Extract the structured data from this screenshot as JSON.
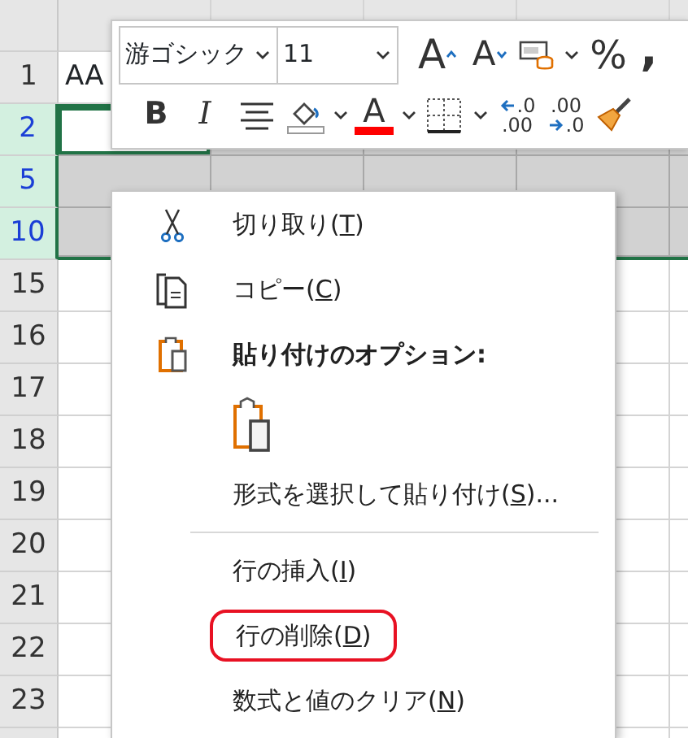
{
  "rows": [
    {
      "number": "1",
      "selected": false,
      "active_cell": false,
      "cells": [
        "AA"
      ]
    },
    {
      "number": "2",
      "selected": true,
      "active_cell": true
    },
    {
      "number": "5",
      "selected": true,
      "active_cell": false
    },
    {
      "number": "10",
      "selected": true,
      "active_cell": false
    },
    {
      "number": "15",
      "selected": false,
      "active_cell": false
    },
    {
      "number": "16",
      "selected": false,
      "active_cell": false
    },
    {
      "number": "17",
      "selected": false,
      "active_cell": false
    },
    {
      "number": "18",
      "selected": false,
      "active_cell": false
    },
    {
      "number": "19",
      "selected": false,
      "active_cell": false
    },
    {
      "number": "20",
      "selected": false,
      "active_cell": false
    },
    {
      "number": "21",
      "selected": false,
      "active_cell": false
    },
    {
      "number": "22",
      "selected": false,
      "active_cell": false
    },
    {
      "number": "23",
      "selected": false,
      "active_cell": false
    }
  ],
  "mini_toolbar": {
    "font": "游ゴシック",
    "size": "11",
    "row_1": [
      {
        "kind": "grow-font",
        "text": "A",
        "dropdown": false
      },
      {
        "kind": "shrink-font",
        "text": "A",
        "dropdown": false
      },
      {
        "kind": "format",
        "dropdown": true
      },
      {
        "kind": "percent",
        "text": "%",
        "dropdown": false
      },
      {
        "kind": "comma",
        "text": ",",
        "dropdown": false
      }
    ],
    "row_2": [
      {
        "kind": "bold",
        "text": "B",
        "dropdown": false
      },
      {
        "kind": "italic",
        "text": "I",
        "dropdown": false
      },
      {
        "kind": "align",
        "dropdown": false
      },
      {
        "kind": "fill",
        "dropdown": true
      },
      {
        "kind": "font-color",
        "text": "A",
        "color": "#ff0000",
        "dropdown": true
      },
      {
        "kind": "borders",
        "dropdown": true
      },
      {
        "kind": "increase-decimal",
        "text": ".0",
        "text_2": ".00",
        "dropdown": false
      },
      {
        "kind": "decrease-decimal",
        "text": ".00",
        "text_2": ".0",
        "dropdown": false
      },
      {
        "kind": "brush",
        "dropdown": false
      }
    ]
  },
  "context_menu": {
    "items": [
      {
        "kind": "command",
        "label": [
          "切り取り(",
          "T",
          ")"
        ],
        "highlighted": false
      },
      {
        "kind": "command",
        "label": [
          "コピー(",
          "C",
          ")"
        ],
        "highlighted": false
      },
      {
        "kind": "heading",
        "label": [
          "貼り付けのオプション:"
        ]
      },
      {
        "kind": "paste-options"
      },
      {
        "kind": "command",
        "label": [
          "形式を選択して貼り付け(",
          "S",
          ")..."
        ],
        "highlighted": false
      },
      {
        "kind": "separator"
      },
      {
        "kind": "command",
        "label": [
          "行の挿入(",
          "I",
          ")"
        ],
        "highlighted": false
      },
      {
        "kind": "command",
        "label": [
          "行の削除(",
          "D",
          ")"
        ],
        "highlighted": true
      },
      {
        "kind": "command",
        "label": [
          "数式と値のクリア(",
          "N",
          ")"
        ],
        "highlighted": false
      }
    ]
  }
}
